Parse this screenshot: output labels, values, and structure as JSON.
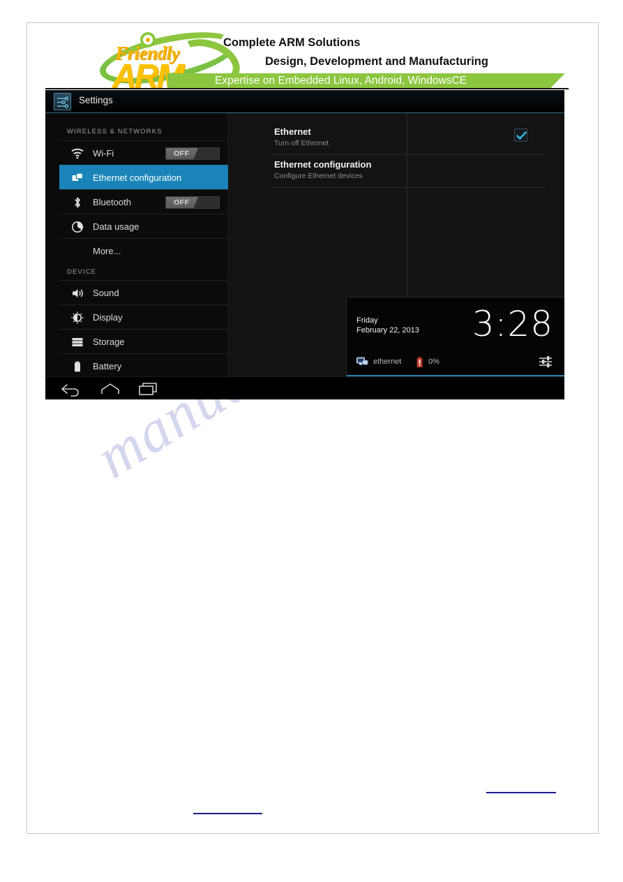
{
  "page": {
    "watermark": "manualshive.com"
  },
  "header": {
    "logo": {
      "word_top": "Friendly",
      "word_bottom": "ARM"
    },
    "line1": "Complete ARM Solutions",
    "line2": "Design, Development and  Manufacturing",
    "ribbon": "Expertise on Embedded Linux, Android, WindowsCE",
    "colors": {
      "green": "#8cc63f",
      "yellow": "#fcc200"
    }
  },
  "tablet": {
    "actionbar": {
      "icon": "settings-sliders-icon",
      "title": "Settings"
    },
    "sidebar": {
      "groups": [
        {
          "title": "WIRELESS & NETWORKS",
          "items": [
            {
              "label": "Wi-Fi",
              "icon": "wifi-icon",
              "toggle": "OFF",
              "selected": false
            },
            {
              "label": "Ethernet configuration",
              "icon": "ethernet-icon",
              "toggle": null,
              "selected": true
            },
            {
              "label": "Bluetooth",
              "icon": "bluetooth-icon",
              "toggle": "OFF",
              "selected": false
            },
            {
              "label": "Data usage",
              "icon": "data-usage-icon",
              "toggle": null,
              "selected": false
            },
            {
              "label": "More...",
              "icon": null,
              "toggle": null,
              "selected": false
            }
          ]
        },
        {
          "title": "DEVICE",
          "items": [
            {
              "label": "Sound",
              "icon": "sound-icon",
              "toggle": null,
              "selected": false
            },
            {
              "label": "Display",
              "icon": "display-icon",
              "toggle": null,
              "selected": false
            },
            {
              "label": "Storage",
              "icon": "storage-icon",
              "toggle": null,
              "selected": false
            },
            {
              "label": "Battery",
              "icon": "battery-icon",
              "toggle": null,
              "selected": false
            }
          ]
        }
      ],
      "selected_color": "#1a84b8"
    },
    "content": {
      "preferences": [
        {
          "title": "Ethernet",
          "summary": "Turn off Ethernet",
          "checkbox": true
        },
        {
          "title": "Ethernet configuration",
          "summary": "Configure Ethernet devices",
          "checkbox": false
        }
      ]
    },
    "notification_panel": {
      "day": "Friday",
      "date": "February 22, 2013",
      "clock": "3:28",
      "network_icon": "ethernet-monitor-icon",
      "network_label": "ethernet",
      "battery_icon": "battery-alert-icon",
      "battery_percent": "0%",
      "quick_settings_icon": "settings-sliders-icon",
      "accent_color": "#2b83ad"
    },
    "navbar": {
      "buttons": [
        {
          "name": "back",
          "icon": "back-arrow-icon"
        },
        {
          "name": "home",
          "icon": "home-icon"
        },
        {
          "name": "recents",
          "icon": "recents-icon"
        }
      ]
    }
  }
}
